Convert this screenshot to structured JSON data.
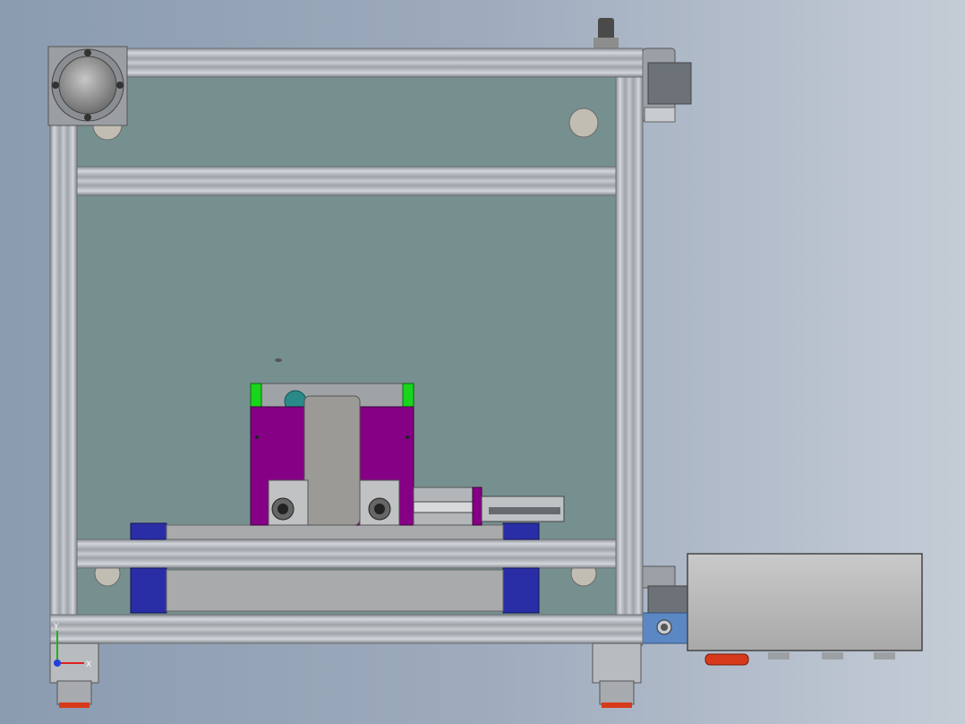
{
  "view": {
    "type": "cad-3d-viewport",
    "background_colors": [
      "#8b9bb0",
      "#9eabbd",
      "#c4ccd6"
    ]
  },
  "model_colors": {
    "aluminum_frame": "#b8bcc1",
    "frame_shadow": "#8c9197",
    "panel": "#76908f",
    "purple_part": "#850085",
    "blue_block": "#2a2ea6",
    "green_tab": "#18d61c",
    "gray_part": "#9c9a96",
    "red_foot": "#d73a1a",
    "steel_blue_bracket": "#5b88c4"
  },
  "triad": {
    "x_label": "X",
    "y_label": "Y",
    "x_color": "#e02020",
    "y_color": "#20b020",
    "z_color": "#2040e0"
  }
}
